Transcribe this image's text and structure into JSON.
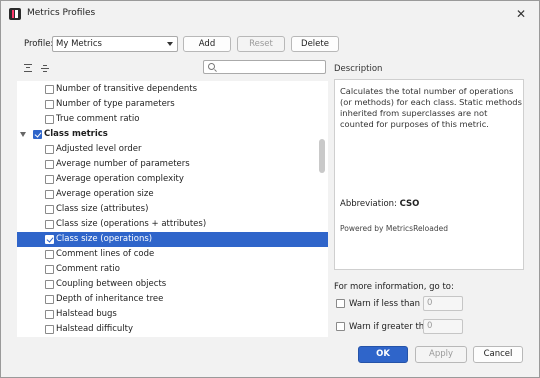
{
  "window": {
    "title": "Metrics Profiles"
  },
  "profile": {
    "label": "Profile:",
    "selected": "My Metrics",
    "add_label": "Add",
    "reset_label": "Reset",
    "delete_label": "Delete"
  },
  "search": {
    "placeholder": ""
  },
  "tree": {
    "rows": [
      {
        "label": "Number of transitive dependents",
        "checked": false
      },
      {
        "label": "Number of type parameters",
        "checked": false
      },
      {
        "label": "True comment ratio",
        "checked": false
      },
      {
        "label": "Class metrics",
        "checked": true,
        "group": true
      },
      {
        "label": "Adjusted level order",
        "checked": false
      },
      {
        "label": "Average number of parameters",
        "checked": false
      },
      {
        "label": "Average operation complexity",
        "checked": false
      },
      {
        "label": "Average operation size",
        "checked": false
      },
      {
        "label": "Class size (attributes)",
        "checked": false
      },
      {
        "label": "Class size (operations + attributes)",
        "checked": false
      },
      {
        "label": "Class size (operations)",
        "checked": true,
        "selected": true
      },
      {
        "label": "Comment lines of code",
        "checked": false
      },
      {
        "label": "Comment ratio",
        "checked": false
      },
      {
        "label": "Coupling between objects",
        "checked": false
      },
      {
        "label": "Depth of inheritance tree",
        "checked": false
      },
      {
        "label": "Halstead bugs",
        "checked": false
      },
      {
        "label": "Halstead difficulty",
        "checked": false
      }
    ]
  },
  "description": {
    "label": "Description",
    "text": "Calculates the total number of operations (or methods) for each class. Static methods inherited from superclasses are not counted for purposes of this metric.",
    "abbreviation_label": "Abbreviation:",
    "abbreviation_value": "CSO",
    "powered_by": "Powered by MetricsReloaded"
  },
  "thresholds": {
    "more_info": "For more information, go to:",
    "warn_less_label": "Warn if less than",
    "warn_less_value": "0",
    "warn_greater_label": "Warn if greater than",
    "warn_greater_value": "0"
  },
  "footer": {
    "ok_label": "OK",
    "apply_label": "Apply",
    "cancel_label": "Cancel"
  },
  "colors": {
    "accent": "#2f65ca"
  }
}
